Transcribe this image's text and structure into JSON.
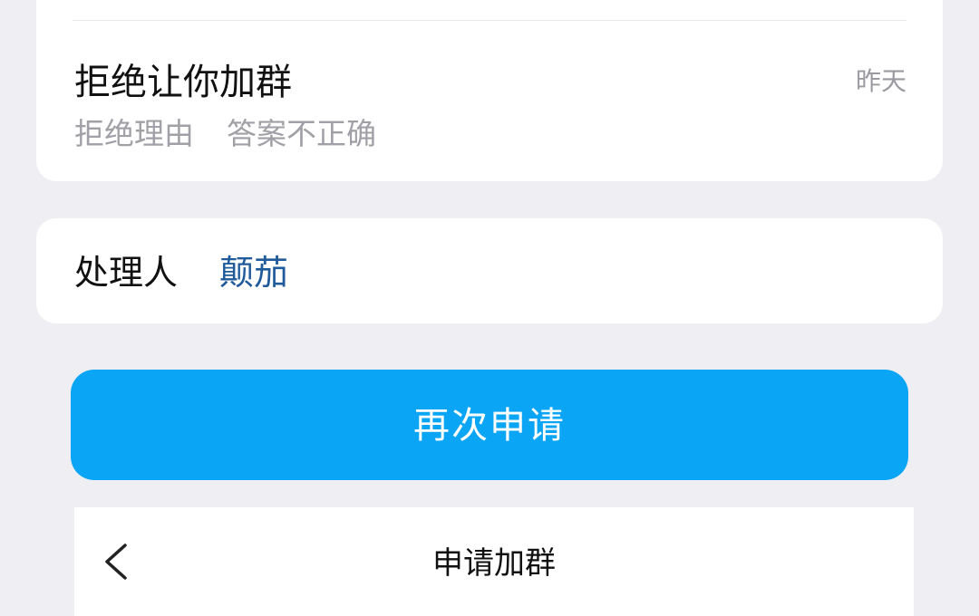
{
  "request_status": {
    "title": "拒绝让你加群",
    "time": "昨天",
    "reason_label": "拒绝理由",
    "reason_value": "答案不正确"
  },
  "handler": {
    "label": "处理人",
    "name": "颠茄"
  },
  "actions": {
    "reapply_label": "再次申请"
  },
  "nav": {
    "title": "申请加群",
    "back_icon": "chevron-left-icon"
  },
  "colors": {
    "background": "#efeff3",
    "card": "#ffffff",
    "primary_button": "#0aa5f5",
    "link_name": "#1f5a9a",
    "secondary_text": "#a0a0a6"
  }
}
